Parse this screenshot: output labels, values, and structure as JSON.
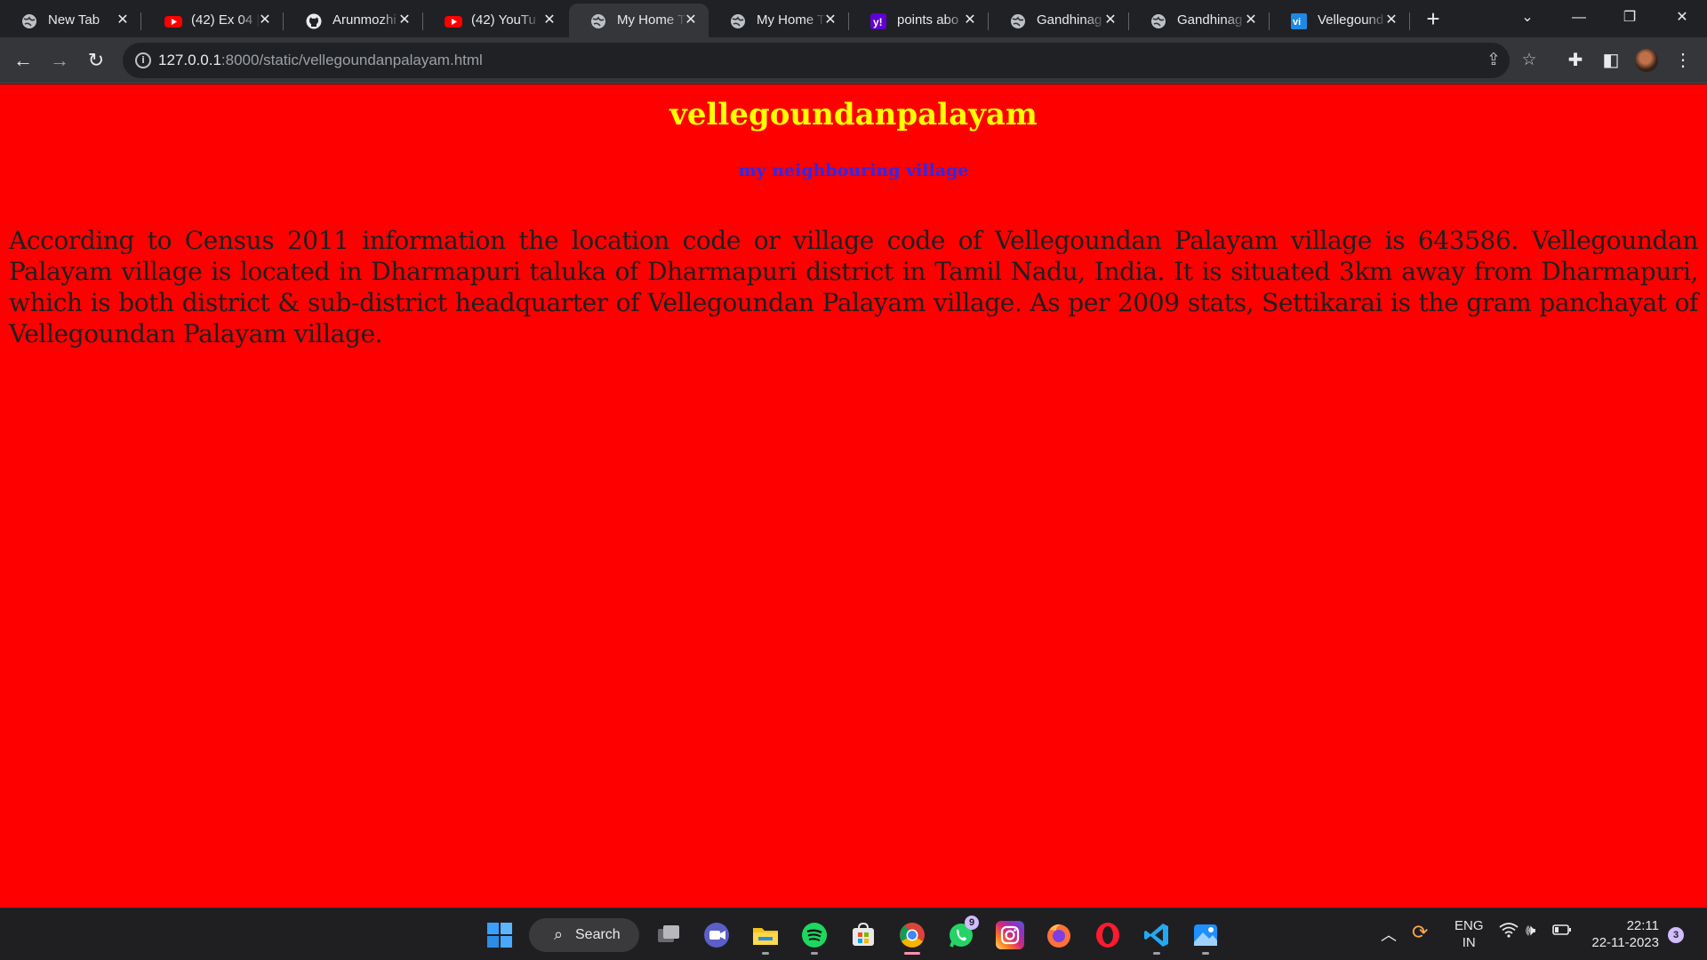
{
  "browser": {
    "tabs": [
      {
        "title": "New Tab",
        "favicon": "globe-icon"
      },
      {
        "title": "(42) Ex 04 |",
        "favicon": "youtube-icon"
      },
      {
        "title": "Arunmozhi",
        "favicon": "github-icon"
      },
      {
        "title": "(42) YouTu",
        "favicon": "youtube-icon"
      },
      {
        "title": "My Home T",
        "favicon": "globe-icon",
        "active": true
      },
      {
        "title": "My Home T",
        "favicon": "globe-icon"
      },
      {
        "title": "points abo",
        "favicon": "yahoo-icon"
      },
      {
        "title": "Gandhinag",
        "favicon": "globe-icon"
      },
      {
        "title": "Gandhinag",
        "favicon": "globe-icon"
      },
      {
        "title": "Vellegound",
        "favicon": "vi-icon"
      }
    ],
    "url_host": "127.0.0.1",
    "url_rest": ":8000/static/vellegoundanpalayam.html"
  },
  "page": {
    "heading": "vellegoundanpalayam",
    "subheading": "my neighbouring village",
    "paragraph": "According to Census 2011 information the location code or village code of Vellegoundan Palayam village is 643586. Vellegoundan Palayam village is located in Dharmapuri taluka of Dharmapuri district in Tamil Nadu, India. It is situated 3km away from Dharmapuri, which is both district & sub-district headquarter of Vellegoundan Palayam village. As per 2009 stats, Settikarai is the gram panchayat of Vellegoundan Palayam village.",
    "colors": {
      "background": "#ff0000",
      "heading": "#ffff00",
      "subheading": "#2a2af0",
      "text": "#202020"
    }
  },
  "taskbar": {
    "search_label": "Search",
    "whatsapp_badge": "9",
    "language": "ENG",
    "region": "IN",
    "time": "22:11",
    "date": "22-11-2023",
    "notification_count": "3"
  }
}
